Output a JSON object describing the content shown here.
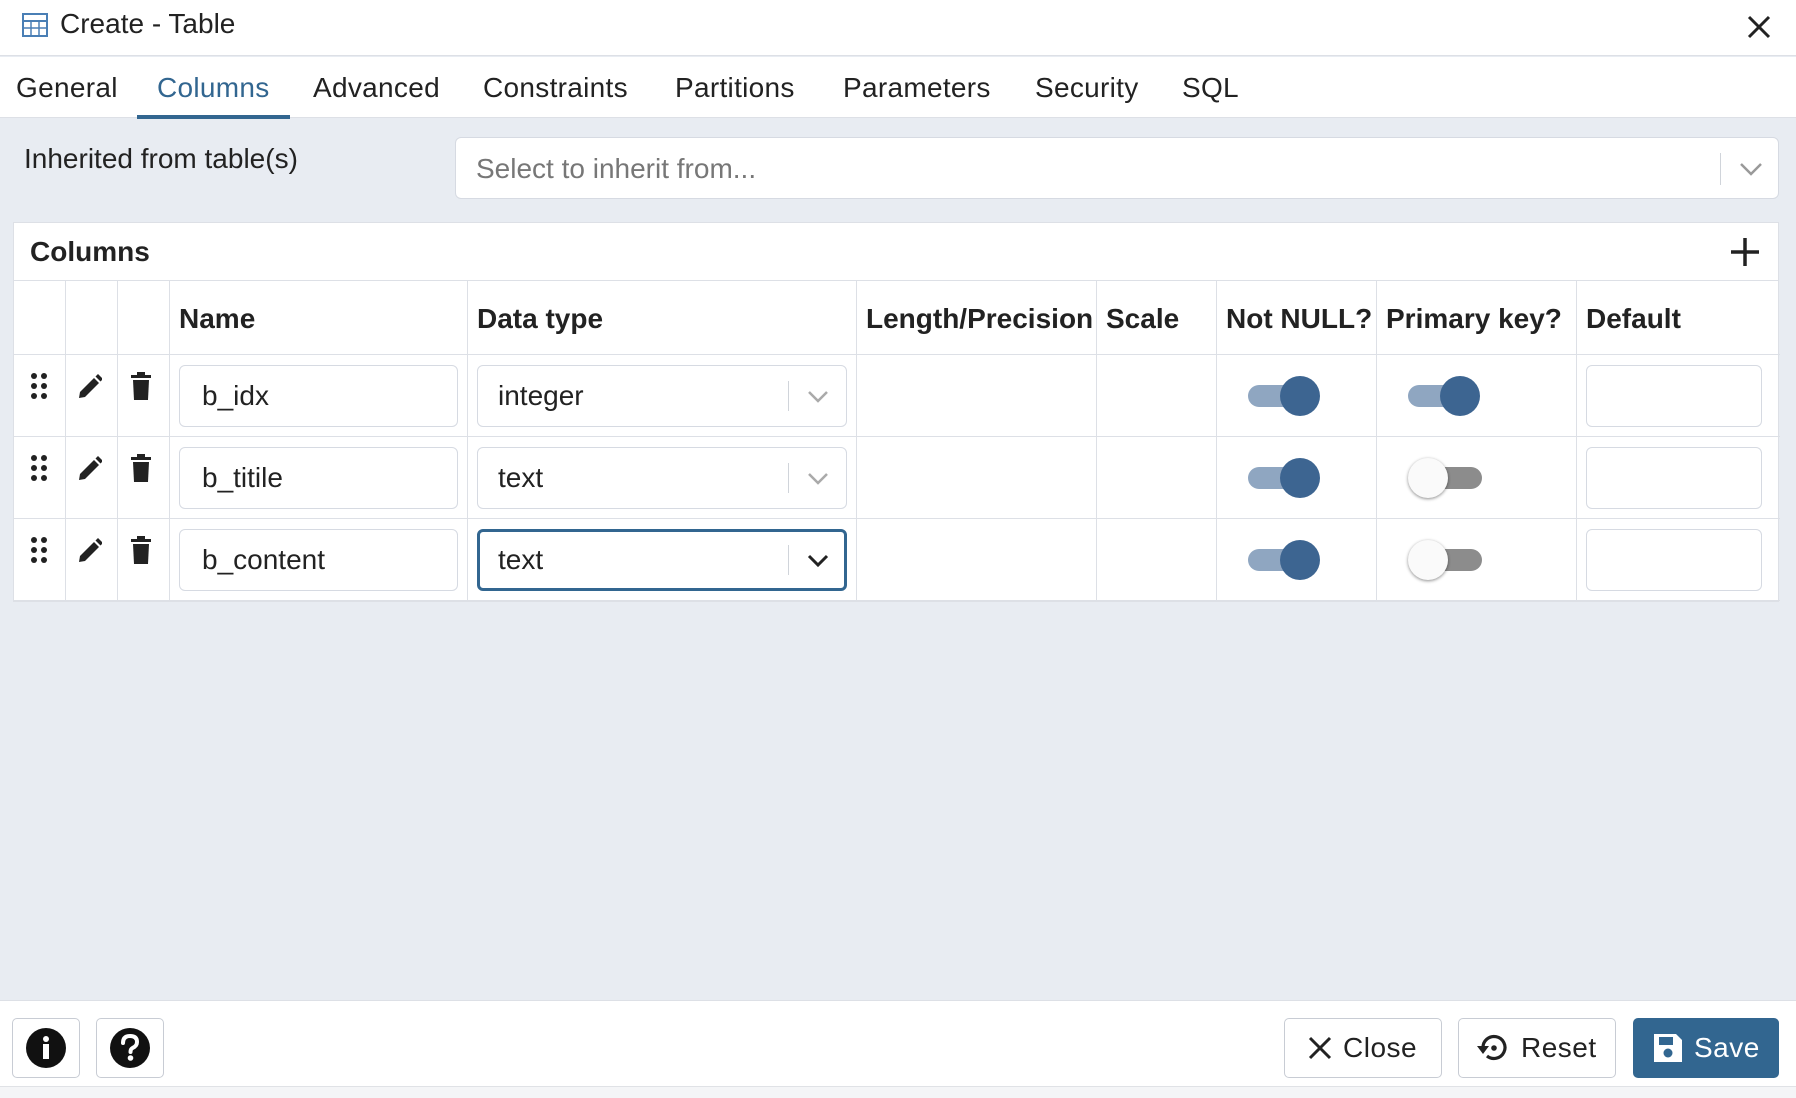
{
  "dialog": {
    "title": "Create - Table"
  },
  "tabs": [
    {
      "label": "General"
    },
    {
      "label": "Columns"
    },
    {
      "label": "Advanced"
    },
    {
      "label": "Constraints"
    },
    {
      "label": "Partitions"
    },
    {
      "label": "Parameters"
    },
    {
      "label": "Security"
    },
    {
      "label": "SQL"
    }
  ],
  "active_tab": "Columns",
  "inherit": {
    "label": "Inherited from table(s)",
    "placeholder": "Select to inherit from..."
  },
  "columns_panel": {
    "title": "Columns",
    "headers": {
      "name": "Name",
      "data_type": "Data type",
      "length": "Length/Precision",
      "scale": "Scale",
      "not_null": "Not NULL?",
      "primary_key": "Primary key?",
      "default": "Default"
    },
    "rows": [
      {
        "name": "b_idx",
        "data_type": "integer",
        "length": "",
        "scale": "",
        "not_null": true,
        "primary_key": true,
        "default": ""
      },
      {
        "name": "b_titile",
        "data_type": "text",
        "length": "",
        "scale": "",
        "not_null": true,
        "primary_key": false,
        "default": ""
      },
      {
        "name": "b_content",
        "data_type": "text",
        "length": "",
        "scale": "",
        "not_null": true,
        "primary_key": false,
        "default": ""
      }
    ]
  },
  "footer": {
    "close_label": "Close",
    "reset_label": "Reset",
    "save_label": "Save"
  },
  "colors": {
    "accent": "#326690",
    "toggle_on_knob": "#3d6591",
    "toggle_on_track": "#8fa6c1",
    "background": "#e8ecf2"
  }
}
